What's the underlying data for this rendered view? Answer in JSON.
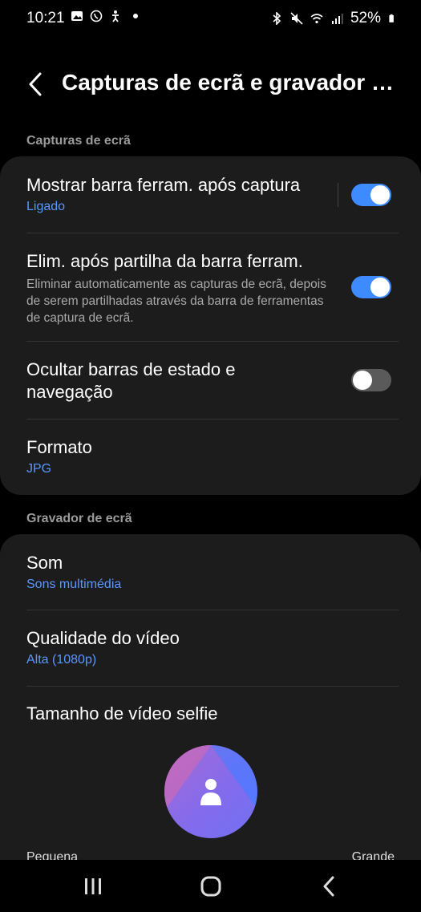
{
  "status_bar": {
    "time": "10:21",
    "battery": "52%",
    "left_icons": [
      "gallery-icon",
      "whatsapp-icon",
      "accessibility-icon",
      "dot"
    ],
    "right_icons": [
      "bluetooth-icon",
      "mute-icon",
      "wifi-icon",
      "signal-icon",
      "battery-icon"
    ]
  },
  "header": {
    "title": "Capturas de ecrã e gravador d..."
  },
  "sections": {
    "screenshots_label": "Capturas de ecrã",
    "recorder_label": "Gravador de ecrã"
  },
  "screenshots": {
    "toolbar": {
      "title": "Mostrar barra ferram. após captura",
      "sub": "Ligado",
      "enabled": true
    },
    "delete_after_share": {
      "title": "Elim. após partilha da barra ferram.",
      "desc": "Eliminar automaticamente as capturas de ecrã, depois de serem partilhadas através da barra de ferramentas de captura de ecrã.",
      "enabled": true
    },
    "hide_bars": {
      "title_line1": "Ocultar barras de estado e",
      "title_line2": "navegação",
      "enabled": false
    },
    "format": {
      "title": "Formato",
      "sub": "JPG"
    }
  },
  "recorder": {
    "sound": {
      "title": "Som",
      "sub": "Sons multimédia"
    },
    "quality": {
      "title": "Qualidade do vídeo",
      "sub": "Alta (1080p)"
    },
    "selfie": {
      "title": "Tamanho de vídeo selfie",
      "min_label": "Pequena",
      "max_label": "Grande"
    }
  },
  "colors": {
    "accent": "#3e8bff",
    "link": "#5a96ff",
    "card": "#1c1c1c"
  }
}
